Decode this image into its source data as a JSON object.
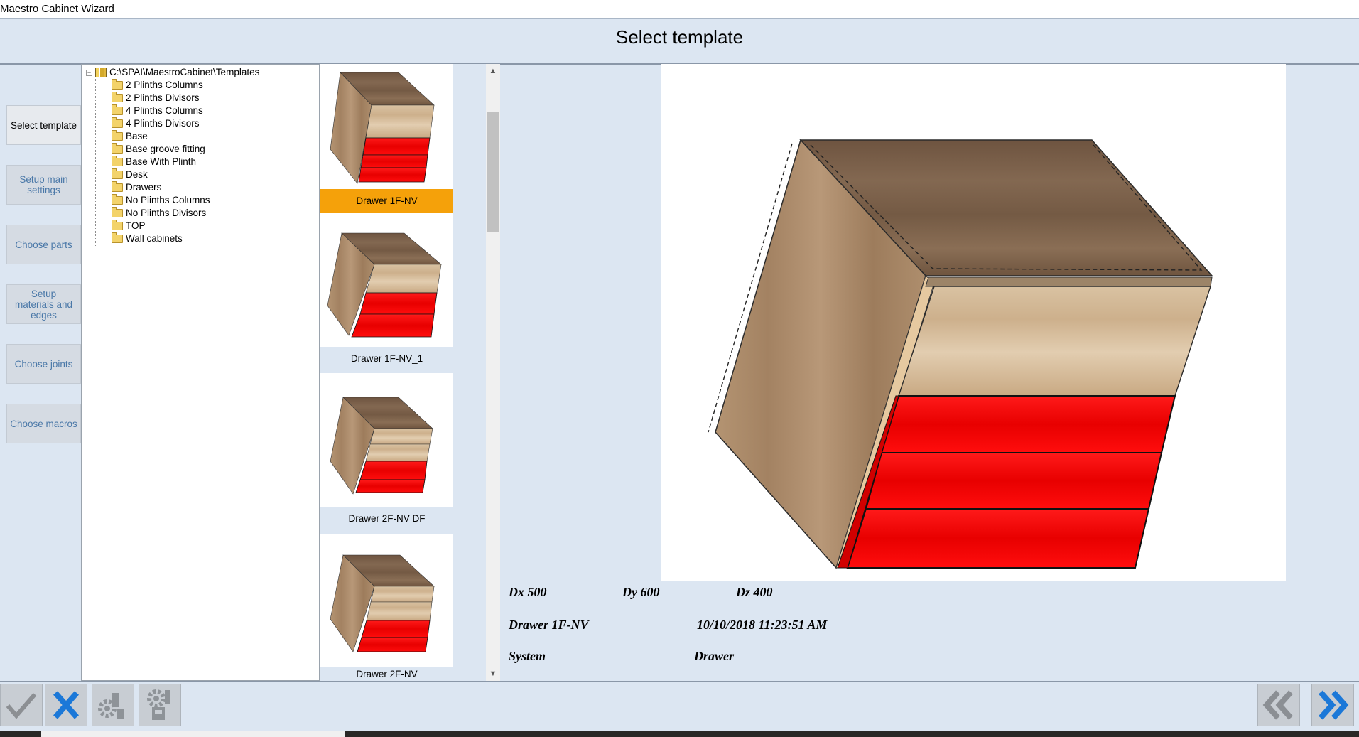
{
  "window": {
    "title": "Maestro Cabinet Wizard"
  },
  "header": {
    "title": "Select template"
  },
  "steps": [
    {
      "label": "Select template"
    },
    {
      "label": "Setup main settings"
    },
    {
      "label": "Choose parts"
    },
    {
      "label": "Setup materials and edges"
    },
    {
      "label": "Choose joints"
    },
    {
      "label": "Choose macros"
    }
  ],
  "tree": {
    "root": "C:\\SPAI\\MaestroCabinet\\Templates",
    "folders": [
      "2 Plinths Columns",
      "2 Plinths Divisors",
      "4 Plinths Columns",
      "4 Plinths Divisors",
      "Base",
      "Base groove fitting",
      "Base With Plinth",
      "Desk",
      "Drawers",
      "No Plinths Columns",
      "No Plinths Divisors",
      "TOP",
      "Wall cabinets"
    ]
  },
  "templates": [
    {
      "label": "Drawer 1F-NV",
      "selected": true
    },
    {
      "label": "Drawer 1F-NV_1",
      "selected": false
    },
    {
      "label": "Drawer 2F-NV DF",
      "selected": false
    },
    {
      "label": "Drawer 2F-NV",
      "selected": false
    }
  ],
  "info": {
    "dx": "Dx 500",
    "dy": "Dy 600",
    "dz": "Dz 400",
    "name": "Drawer 1F-NV",
    "date": "10/10/2018 11:23:51 AM",
    "owner": "System",
    "category": "Drawer"
  },
  "toolbar": {
    "ok_icon": "check-icon",
    "cancel_icon": "x-icon",
    "back_icon": "double-chevron-left-icon",
    "next_icon": "double-chevron-right-icon"
  },
  "colors": {
    "background": "#dce6f2",
    "selected": "#f5a10a",
    "drawer_front": "#ee0000",
    "wood_dark": "#7e6245",
    "wood_light": "#d8bd98",
    "accent_blue": "#1e7fe0"
  }
}
